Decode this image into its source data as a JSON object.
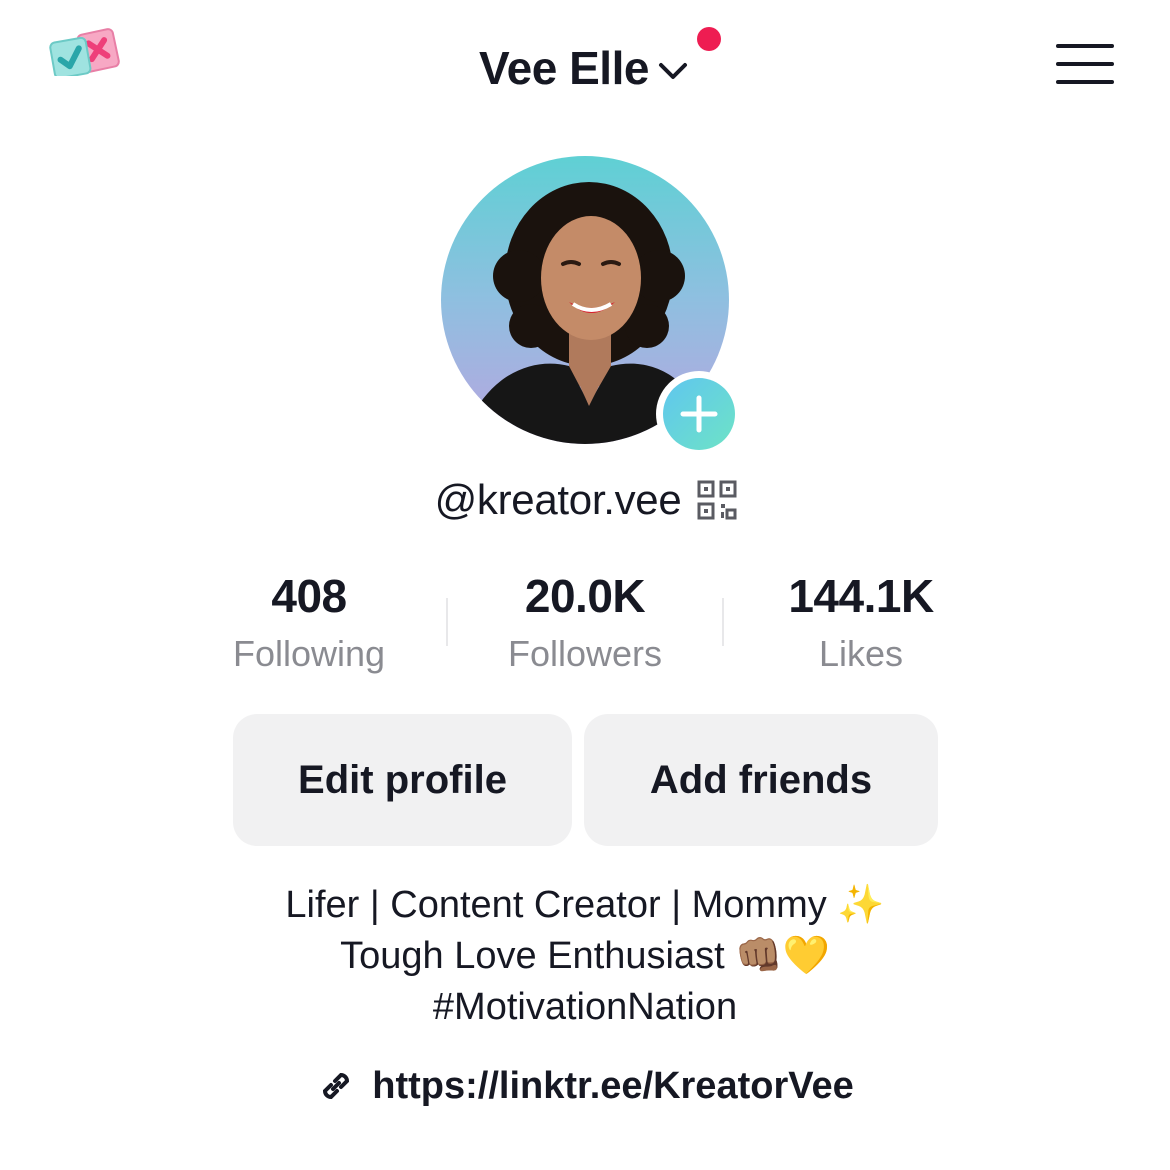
{
  "header": {
    "app_logo_icon": "checklist-logo-icon",
    "account_name": "Vee Elle",
    "chevron_icon": "chevron-down-icon",
    "notification_dot_color": "#ee1d52",
    "menu_icon": "hamburger-menu-icon"
  },
  "profile": {
    "avatar_icon": "profile-photo",
    "add_avatar_icon": "plus-icon",
    "accent_gradient": [
      "#5fc6ef",
      "#6ee3c6"
    ],
    "username": "@kreator.vee",
    "qr_icon": "qr-code-icon"
  },
  "stats": [
    {
      "value": "408",
      "label": "Following"
    },
    {
      "value": "20.0K",
      "label": "Followers"
    },
    {
      "value": "144.1K",
      "label": "Likes"
    }
  ],
  "actions": {
    "edit_profile": "Edit profile",
    "add_friends": "Add friends"
  },
  "bio": {
    "lines": [
      "Lifer | Content Creator | Mommy ✨",
      "Tough Love Enthusiast 👊🏽💛",
      "#MotivationNation"
    ]
  },
  "link": {
    "icon": "link-icon",
    "url": "https://linktr.ee/KreatorVee"
  }
}
